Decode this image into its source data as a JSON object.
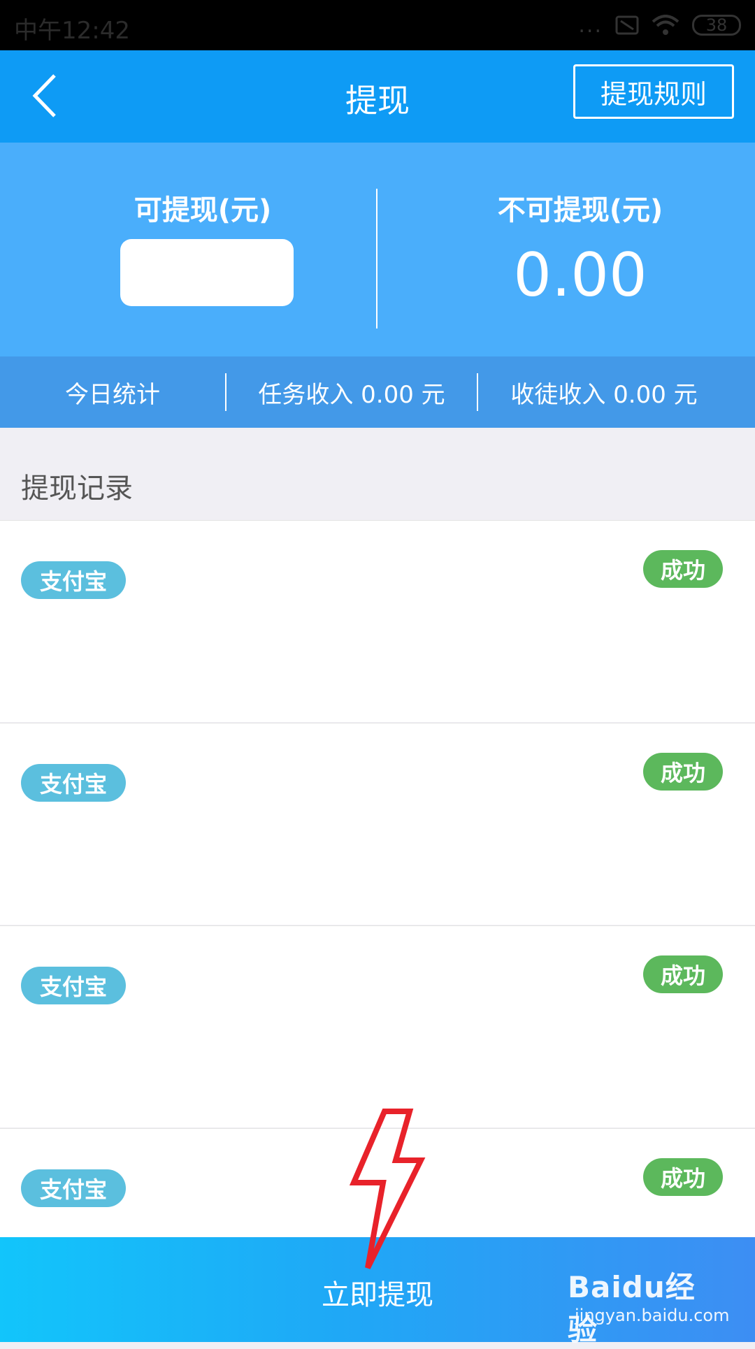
{
  "status_bar": {
    "time": "中午12:42",
    "battery": "38",
    "more": "..."
  },
  "header": {
    "title": "提现",
    "rules_label": "提现规则"
  },
  "balance": {
    "withdrawable_label": "可提现(元)",
    "non_withdrawable_label": "不可提现(元)",
    "non_withdrawable_value": "0.00"
  },
  "stats": {
    "today_label": "今日统计",
    "task_income": "任务收入 0.00 元",
    "apprentice_income": "收徒收入 0.00 元"
  },
  "records": {
    "section_title": "提现记录",
    "items": [
      {
        "method": "支付宝",
        "status": "成功"
      },
      {
        "method": "支付宝",
        "status": "成功"
      },
      {
        "method": "支付宝",
        "status": "成功"
      },
      {
        "method": "支付宝",
        "status": "成功"
      }
    ]
  },
  "bottom": {
    "withdraw_now": "立即提现"
  },
  "watermark": {
    "brand": "Baidu经验",
    "url": "jingyan.baidu.com"
  },
  "colors": {
    "header": "#0e9bf5",
    "balance_bg": "#4aaefb",
    "stats_bg": "#4399e8",
    "success": "#5cb85c",
    "alipay": "#5bbfde",
    "annotation": "#e8222a"
  },
  "icons": [
    "back-arrow-icon",
    "wifi-icon",
    "battery-icon",
    "lightning-bolt-icon"
  ]
}
